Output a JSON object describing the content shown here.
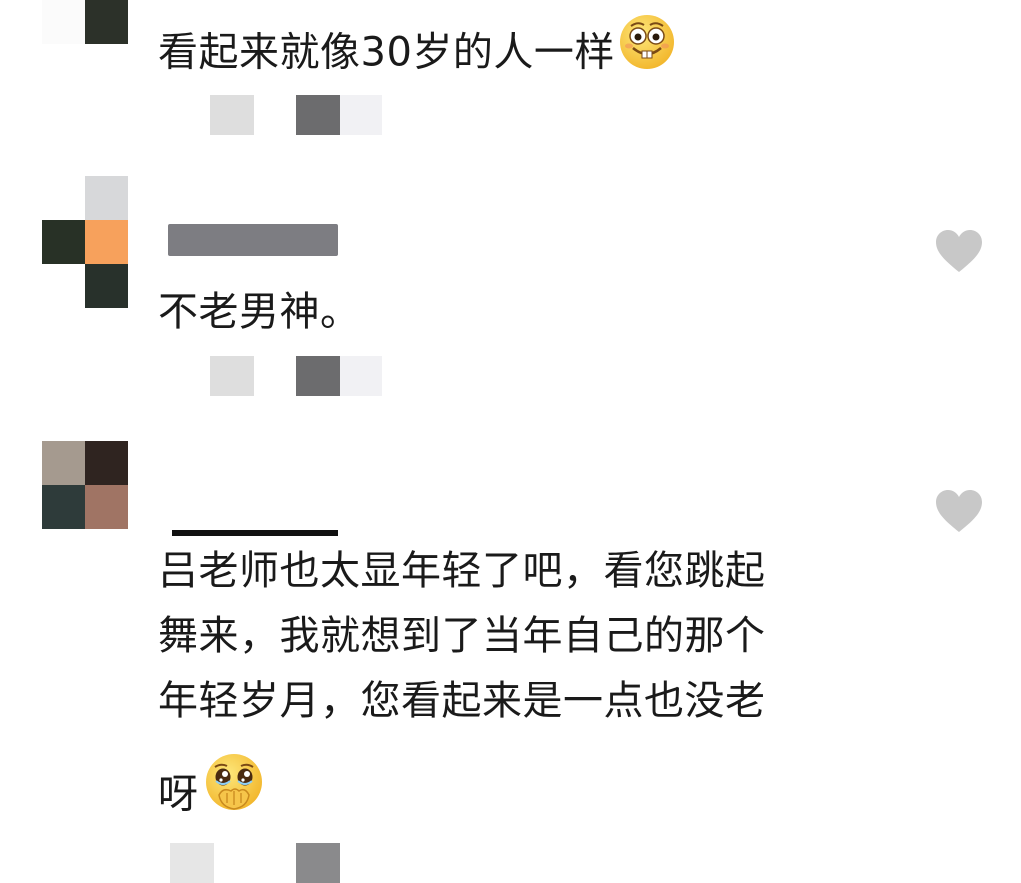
{
  "comments": [
    {
      "text": "看起来就像30岁的人一样",
      "emoji": "grinning-buck-teeth-face"
    },
    {
      "text": "不老男神。",
      "emoji": ""
    },
    {
      "lines": [
        "吕老师也太显年轻了吧，看您跳起",
        "舞来，我就想到了当年自己的那个",
        "年轻岁月，您看起来是一点也没老",
        "呀"
      ],
      "emoji": "tearful-hand-over-mouth-face"
    }
  ],
  "colors": {
    "text": "#1a1a1a",
    "like_icon": "#c8c8c8",
    "emoji_yellow": "#f9c93c"
  },
  "icons": {
    "like": "heart-icon"
  }
}
